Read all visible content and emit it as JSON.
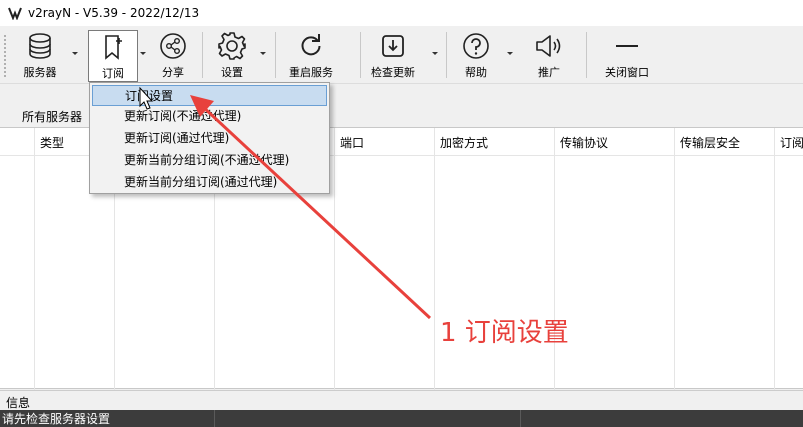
{
  "window": {
    "title": "v2rayN - V5.39 - 2022/12/13"
  },
  "toolbar": {
    "items": [
      {
        "label": "服务器",
        "icon": "database-icon"
      },
      {
        "label": "订阅",
        "icon": "bookmark-plus-icon"
      },
      {
        "label": "分享",
        "icon": "share-icon"
      },
      {
        "label": "设置",
        "icon": "gear-icon"
      },
      {
        "label": "重启服务",
        "icon": "refresh-icon"
      },
      {
        "label": "检查更新",
        "icon": "download-icon"
      },
      {
        "label": "帮助",
        "icon": "help-icon"
      },
      {
        "label": "推广",
        "icon": "megaphone-icon"
      },
      {
        "label": "关闭窗口",
        "icon": "minus-icon"
      }
    ]
  },
  "server_tab": {
    "label": "所有服务器"
  },
  "grid": {
    "columns": [
      "类型",
      "端口",
      "加密方式",
      "传输协议",
      "传输层安全",
      "订阅"
    ]
  },
  "subscription_menu": {
    "items": [
      {
        "label": "订阅设置"
      },
      {
        "label": "更新订阅(不通过代理)"
      },
      {
        "label": "更新订阅(通过代理)"
      },
      {
        "label": "更新当前分组订阅(不通过代理)"
      },
      {
        "label": "更新当前分组订阅(通过代理)"
      }
    ]
  },
  "info_panel": {
    "label": "信息"
  },
  "status_bar": {
    "text": "请先检查服务器设置"
  },
  "annotation": {
    "text": "1 订阅设置",
    "color": "#e8413c"
  }
}
